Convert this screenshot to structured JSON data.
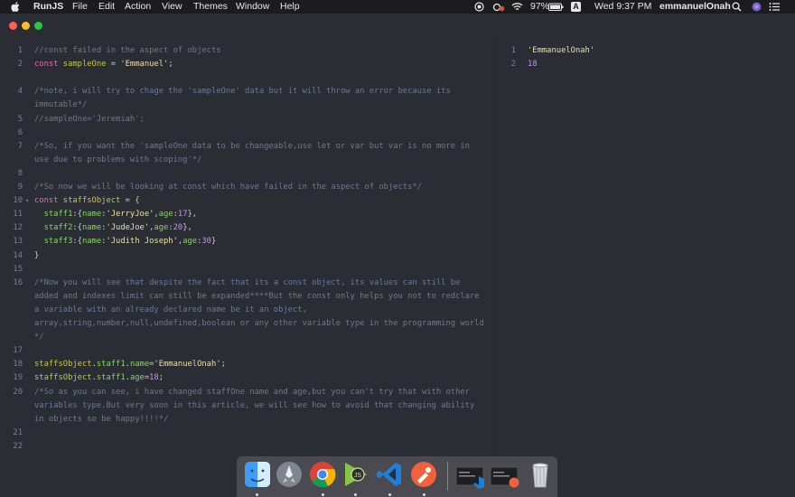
{
  "menubar": {
    "app_name": "RunJS",
    "menus": [
      "File",
      "Edit",
      "Action",
      "View",
      "Themes",
      "Window",
      "Help"
    ],
    "battery": "97%",
    "input_source": "A",
    "clock": "Wed 9:37 PM",
    "user": "emmanuelOnah"
  },
  "editor": {
    "line_numbers": [
      "1",
      "2",
      "",
      "4",
      "",
      "5",
      "6",
      "7",
      "",
      "8",
      "9",
      "10",
      "11",
      "12",
      "13",
      "14",
      "15",
      "16",
      "",
      "",
      "",
      "",
      "17",
      "18",
      "19",
      "20",
      "",
      "",
      "21",
      "22"
    ],
    "lines": [
      "//const failed in the aspect of objects",
      "const sampleOne = 'Emmanuel';",
      "",
      "/*note, i will try to chage the 'sampleOne' data but it will throw an error because its",
      "immutable*/",
      "//sampleOne='Jeremiah';",
      "",
      "/*So, if you want the 'sampleOne data to be changeable,use let or var but var is no more in",
      "use due to problems with scoping'*/",
      "",
      "/*So now we will be looking at const which have failed in the aspect of objects*/",
      "const staffsObject = {",
      "  staff1:{name:'JerryJoe',age:17},",
      "  staff2:{name:'JudeJoe',age:20},",
      "  staff3:{name:'Judith Joseph',age:30}",
      "}",
      "",
      "/*Now you will see that despite the fact that its a const object, its values can still be",
      "added and indexes limit can still be expanded****But the const only helps you not to redclare",
      "a variable with an already declared name be it an object,",
      "array,string,number,null,undefined,boolean or any other variable type in the programming world",
      "*/",
      "",
      "staffsObject.staff1.name='EmmanuelOnah';",
      "staffsObject.staff1.age=18;",
      "/*So as you can see, i have changed staffOne name and age,but you can't try that with other",
      "variables type.But very soon in this article, we will see how to avoid that changing ability",
      "in objects so be happy!!!!*/",
      "",
      ""
    ]
  },
  "output": {
    "lines": [
      {
        "num": "1",
        "value": "'EmmanuelOnah'"
      },
      {
        "num": "2",
        "value": "18"
      }
    ]
  },
  "colors": {
    "comment": "#6f7896",
    "keyword": "#e36cb5",
    "variable": "#c5c74d",
    "string": "#e8e0a8",
    "number": "#c792ea",
    "property": "#8fd16e",
    "background": "#2a2d34"
  },
  "dock": {
    "apps": [
      "finder-icon",
      "launchpad-icon",
      "chrome-icon",
      "runjs-icon",
      "vscode-icon",
      "postman-icon",
      "terminal-vscode-icon",
      "terminal-postman-icon",
      "trash-icon"
    ]
  }
}
